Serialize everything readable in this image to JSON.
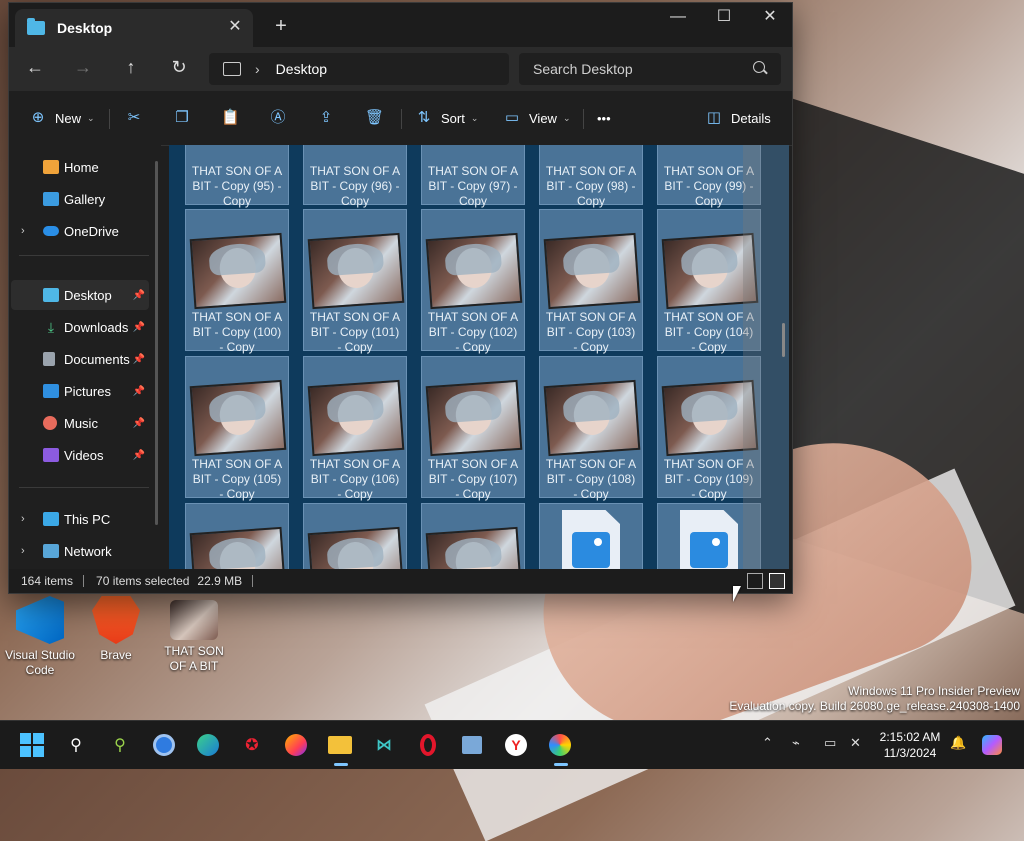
{
  "window": {
    "tab_title": "Desktop",
    "close_tab": "✕",
    "new_tab": "+",
    "minimize": "—",
    "maximize": "☐",
    "close": "✕"
  },
  "nav": {
    "back": "←",
    "forward": "→",
    "up": "↑",
    "refresh": "↻",
    "chevron": "›",
    "breadcrumb": "Desktop",
    "search_placeholder": "Search Desktop"
  },
  "toolbar": {
    "new_label": "New",
    "sort_label": "Sort",
    "view_label": "View",
    "more_label": "•••",
    "details_label": "Details",
    "dropdown": "⌄"
  },
  "sidebar": {
    "items": [
      {
        "label": "Home"
      },
      {
        "label": "Gallery"
      },
      {
        "label": "OneDrive"
      },
      {
        "label": "Desktop"
      },
      {
        "label": "Downloads"
      },
      {
        "label": "Documents"
      },
      {
        "label": "Pictures"
      },
      {
        "label": "Music"
      },
      {
        "label": "Videos"
      },
      {
        "label": "This PC"
      },
      {
        "label": "Network"
      }
    ],
    "pin": "📌",
    "expand": "›"
  },
  "files": {
    "row0": [
      {
        "l1": "THAT SON OF A",
        "l2": "BIT - Copy (95) -",
        "l3": "Copy"
      },
      {
        "l1": "THAT SON OF A",
        "l2": "BIT - Copy (96) -",
        "l3": "Copy"
      },
      {
        "l1": "THAT SON OF A",
        "l2": "BIT - Copy (97) -",
        "l3": "Copy"
      },
      {
        "l1": "THAT SON OF A",
        "l2": "BIT - Copy (98) -",
        "l3": "Copy"
      },
      {
        "l1": "THAT SON OF A",
        "l2": "BIT - Copy (99) -",
        "l3": "Copy"
      }
    ],
    "row1": [
      {
        "l1": "THAT SON OF A",
        "l2": "BIT - Copy (100)",
        "l3": "- Copy"
      },
      {
        "l1": "THAT SON OF A",
        "l2": "BIT - Copy (101)",
        "l3": "- Copy"
      },
      {
        "l1": "THAT SON OF A",
        "l2": "BIT - Copy (102)",
        "l3": "- Copy"
      },
      {
        "l1": "THAT SON OF A",
        "l2": "BIT - Copy (103)",
        "l3": "- Copy"
      },
      {
        "l1": "THAT SON OF A",
        "l2": "BIT - Copy (104)",
        "l3": "- Copy"
      }
    ],
    "row2": [
      {
        "l1": "THAT SON OF A",
        "l2": "BIT - Copy (105)",
        "l3": "- Copy"
      },
      {
        "l1": "THAT SON OF A",
        "l2": "BIT - Copy (106)",
        "l3": "- Copy"
      },
      {
        "l1": "THAT SON OF A",
        "l2": "BIT - Copy (107)",
        "l3": "- Copy"
      },
      {
        "l1": "THAT SON OF A",
        "l2": "BIT - Copy (108)",
        "l3": "- Copy"
      },
      {
        "l1": "THAT SON OF A",
        "l2": "BIT - Copy (109)",
        "l3": "- Copy"
      }
    ]
  },
  "status": {
    "count": "164 items",
    "selected": "70 items selected",
    "size": "22.9 MB"
  },
  "desktop_icons": [
    {
      "label1": "Visual Studio",
      "label2": "Code"
    },
    {
      "label1": "Brave",
      "label2": ""
    },
    {
      "label1": "THAT SON",
      "label2": "OF A BIT"
    }
  ],
  "watermark": {
    "line1": "Windows 11 Pro Insider Preview",
    "line2": "Evaluation copy. Build 26080.ge_release.240308-1400"
  },
  "clock": {
    "time": "2:15:02 AM",
    "date": "11/3/2024"
  },
  "colors": {
    "accent": "#4cc2ff",
    "selection": "#4a7397",
    "content_bg": "#0e3a5c"
  }
}
